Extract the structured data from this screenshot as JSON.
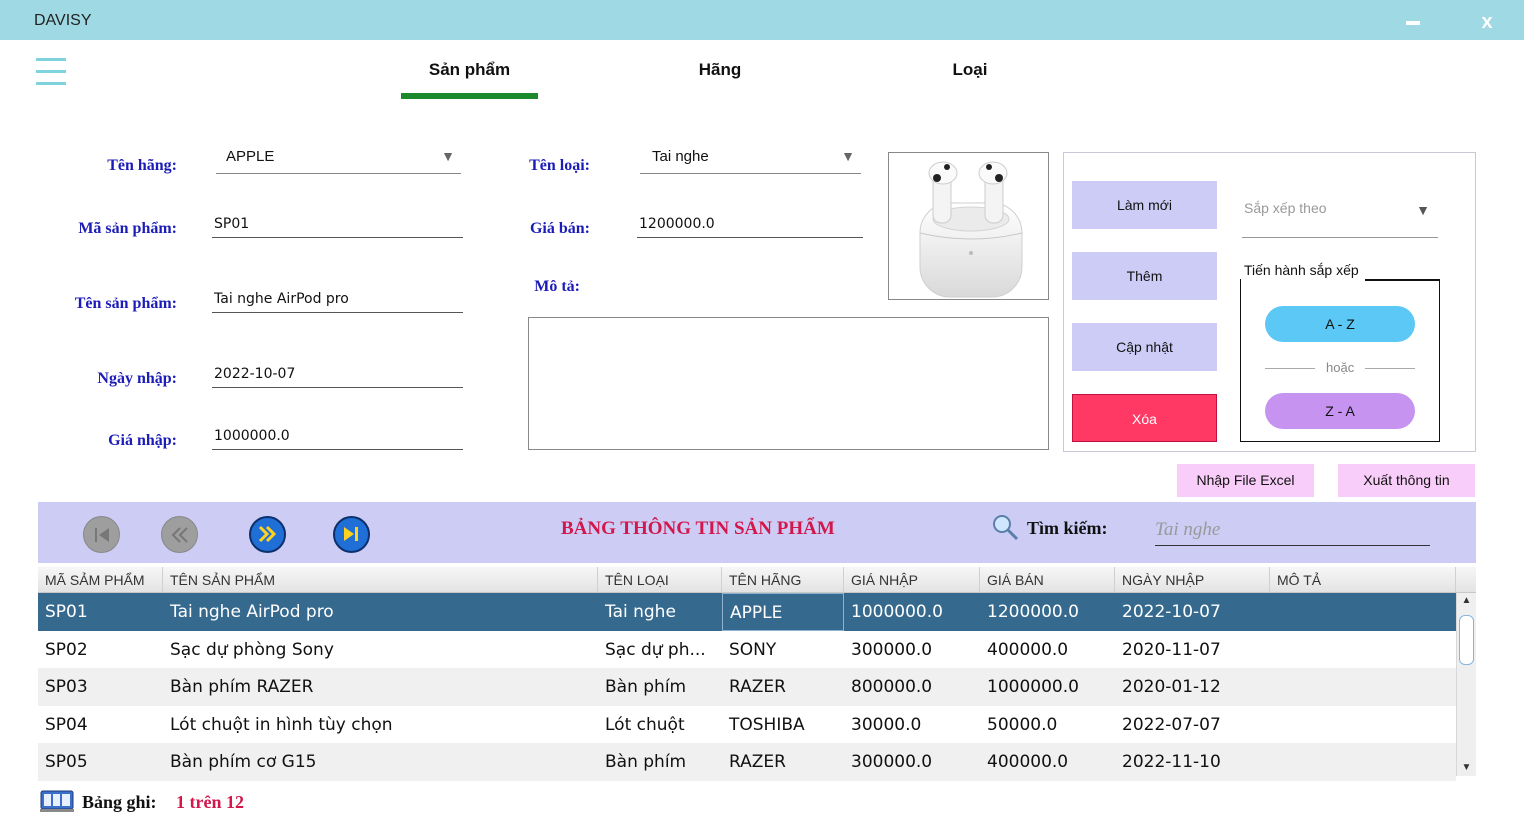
{
  "window": {
    "title": "DAVISY",
    "close_label": "x"
  },
  "tabs": [
    {
      "label": "Sản phẩm"
    },
    {
      "label": "Hãng"
    },
    {
      "label": "Loại"
    }
  ],
  "form": {
    "brand_label": "Tên hãng:",
    "brand_value": "APPLE",
    "product_code_label": "Mã sản phẩm:",
    "product_code_value": "SP01",
    "product_name_label": "Tên sản phẩm:",
    "product_name_value": "Tai nghe AirPod pro",
    "import_date_label": "Ngày nhập:",
    "import_date_value": "2022-10-07",
    "import_price_label": "Giá nhập:",
    "import_price_value": "1000000.0",
    "category_label": "Tên loại:",
    "category_value": "Tai nghe",
    "sale_price_label": "Giá bán:",
    "sale_price_value": "1200000.0",
    "description_label": "Mô tả:",
    "description_value": ""
  },
  "actions": {
    "refresh_label": "Làm mới",
    "add_label": "Thêm",
    "update_label": "Cập nhật",
    "delete_label": "Xóa",
    "sort_placeholder": "Sắp xếp theo",
    "sort_title": "Tiến hành sắp xếp",
    "az_label": "A - Z",
    "or_label": "hoặc",
    "za_label": "Z - A",
    "import_excel_label": "Nhập File Excel",
    "export_label": "Xuất thông tin"
  },
  "table_bar": {
    "title": "BẢNG THÔNG TIN SẢN PHẨM",
    "search_label": "Tìm kiếm:",
    "search_placeholder": "Tai nghe"
  },
  "table": {
    "columns": [
      "MÃ SẢM PHẨM",
      "TÊN SẢN PHẨM",
      "TÊN LOẠI",
      "TÊN HÃNG",
      "GIÁ NHẬP",
      "GIÁ BÁN",
      "NGÀY NHẬP",
      "MÔ TẢ"
    ],
    "rows": [
      [
        "SP01",
        "Tai nghe AirPod pro",
        "Tai nghe",
        "APPLE",
        "1000000.0",
        "1200000.0",
        "2022-10-07",
        ""
      ],
      [
        "SP02",
        "Sạc dự phòng Sony",
        "Sạc dự ph...",
        "SONY",
        "300000.0",
        "400000.0",
        "2020-11-07",
        ""
      ],
      [
        "SP03",
        "Bàn phím RAZER",
        "Bàn phím",
        "RAZER",
        "800000.0",
        "1000000.0",
        "2020-01-12",
        ""
      ],
      [
        "SP04",
        "Lót chuột in hình tùy chọn",
        "Lót chuột",
        "TOSHIBA",
        "30000.0",
        "50000.0",
        "2022-07-07",
        ""
      ],
      [
        "SP05",
        "Bàn phím cơ G15",
        "Bàn phím",
        "RAZER",
        "300000.0",
        "400000.0",
        "2022-11-10",
        ""
      ]
    ]
  },
  "footer": {
    "record_label": "Bảng ghi:",
    "record_value": "1 trên 12"
  },
  "colors": {
    "titlebar": "#9ed9e4",
    "accent_green": "#1b8a2c",
    "label_blue": "#1c1cb8",
    "delete_red": "#ff3864",
    "title_red": "#d3174c",
    "selected_row": "#36698e"
  }
}
